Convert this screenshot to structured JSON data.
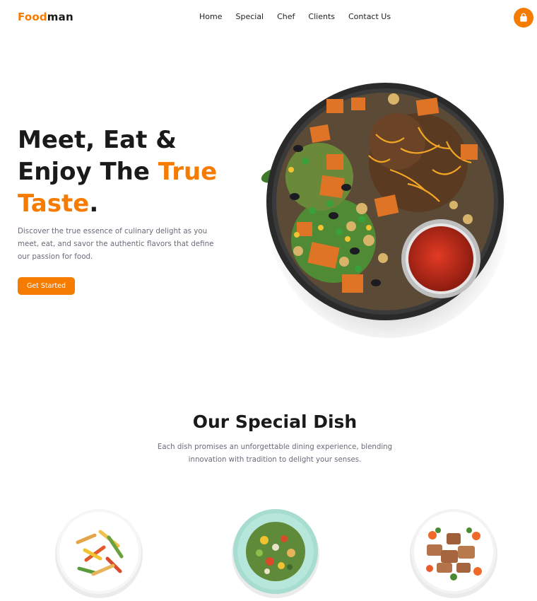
{
  "nav": {
    "logo_accent": "Food",
    "logo_rest": "man",
    "links": [
      "Home",
      "Special",
      "Chef",
      "Clients",
      "Contact Us"
    ],
    "cart_icon": "shopping-bag-icon"
  },
  "hero": {
    "title_line1": "Meet, Eat &",
    "title_line2_plain": "Enjoy The ",
    "title_line2_accent": "True",
    "title_line3_accent": "Taste",
    "title_line3_plain": ".",
    "description": "Discover the true essence of culinary delight as you meet, eat, and savor the authentic flavors that define our passion for food.",
    "cta_label": "Get Started"
  },
  "special": {
    "title": "Our Special Dish",
    "description": "Each dish promises an unforgettable dining experience, blending innovation with tradition to delight your senses."
  },
  "colors": {
    "accent": "#f57c00",
    "text_dark": "#1a1a1a",
    "text_muted": "#6b6b7a"
  }
}
